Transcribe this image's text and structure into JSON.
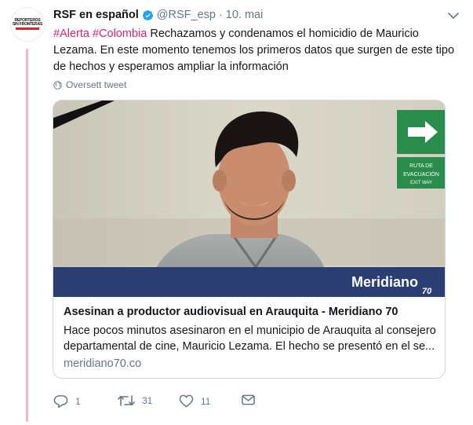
{
  "account": {
    "avatar_text_line1": "REPORTEROS",
    "avatar_text_line2": "SIN FRONTERAS",
    "display_name": "RSF en español",
    "handle": "@RSF_esp",
    "separator": "·",
    "date": "10. mai",
    "verified": true
  },
  "tweet": {
    "hashtag1": "#Alerta",
    "hashtag2": "#Colombia",
    "text": " Rechazamos y condenamos el homicidio de Mauricio Lezama. En este momento tenemos los primeros datos que surgen de este tipo de hechos y esperamos ampliar la información",
    "translate_label": "Oversett tweet"
  },
  "card": {
    "image_logo_text": "Meridiano",
    "image_logo_number": "70",
    "sign_text_line1": "RUTA DE",
    "sign_text_line2": "EVACUACIÓN",
    "sign_text_line3": "EXIT WAY",
    "title": "Asesinan a productor audiovisual en Arauquita - Meridiano 70",
    "description": "Hace pocos minutos asesinaron en el municipio de Arauquita al consejero departamental de cine, Mauricio Lezama. El hecho se presentó en el se...",
    "domain": "meridiano70.co"
  },
  "actions": {
    "reply_count": "1",
    "retweet_count": "31",
    "like_count": "11"
  },
  "colors": {
    "hashtag": "#e0245e",
    "verified": "#1da1f2",
    "thread_line": "#f4b3c2",
    "card_banner": "#2a3e73"
  }
}
